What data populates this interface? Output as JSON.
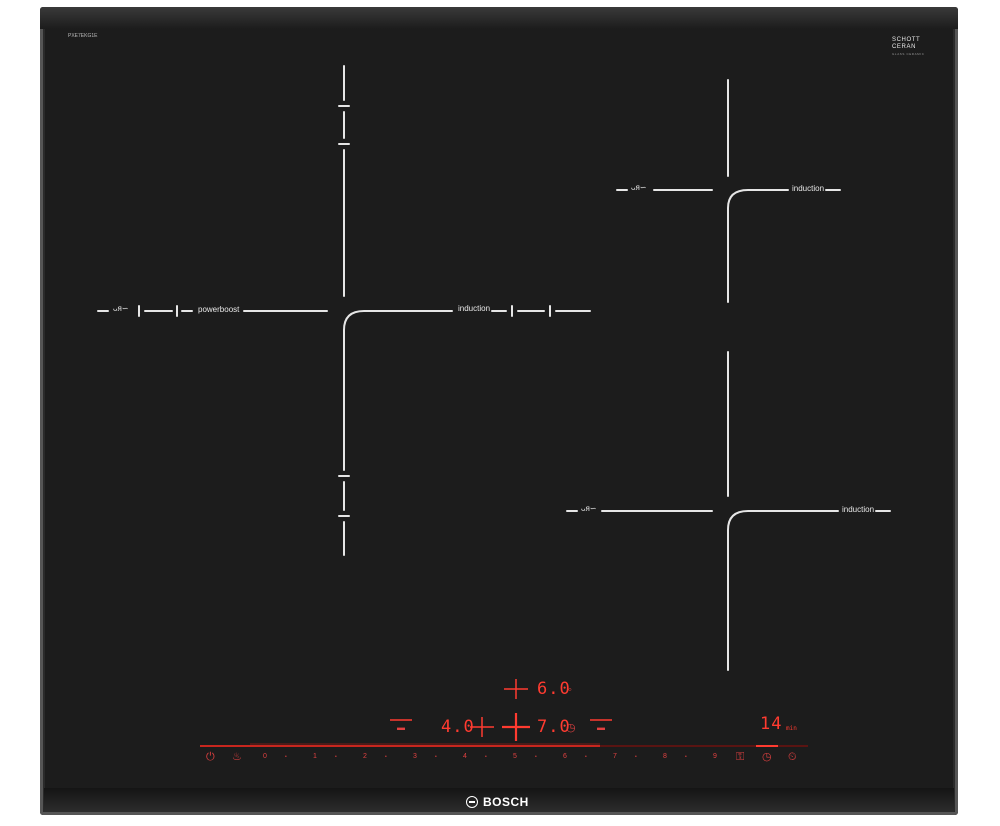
{
  "model_code": "PXE7EKG1E",
  "glass_brand": {
    "line1": "SCHOTT",
    "line2": "CERAN",
    "small": "GLASS CERAMIC"
  },
  "brand": "BOSCH",
  "zones": {
    "left": {
      "label": "induction",
      "boost_label": "powerboost",
      "squiggle": "ᴗᴙ∽"
    },
    "right_top": {
      "label": "induction",
      "squiggle": "ᴗᴙ∽"
    },
    "right_bottom": {
      "label": "induction",
      "squiggle": "ᴗᴙ∽"
    }
  },
  "display": {
    "top_value": "6.0",
    "left_value": "4.0",
    "right_value": "7.0",
    "timer_value": "14",
    "timer_unit": "min"
  },
  "slider_numbers": [
    "0",
    "1",
    "2",
    "3",
    "4",
    "5",
    "6",
    "7",
    "8",
    "9"
  ],
  "colors": {
    "glass": "#1c1c1c",
    "display_red": "#ff3b30",
    "line": "#e6e6e6"
  },
  "icons": [
    "power-icon",
    "flex-zone-icon",
    "child-lock-icon",
    "timer-icon",
    "minute-minder-icon",
    "heat-level-icon"
  ]
}
